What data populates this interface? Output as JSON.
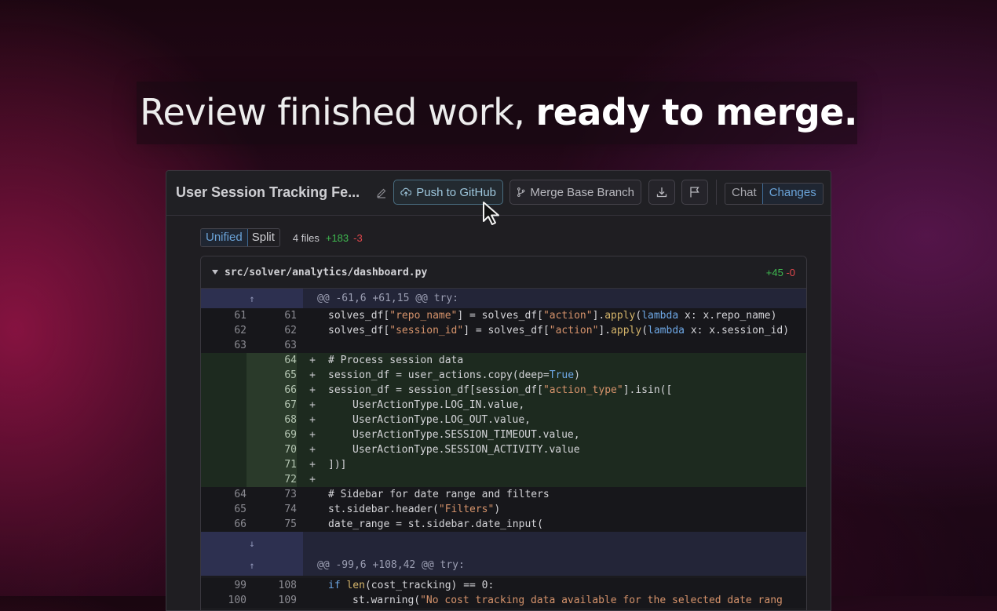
{
  "headline": {
    "regular": "Review finished work, ",
    "bold": "ready to merge."
  },
  "topbar": {
    "title": "User Session Tracking Fe...",
    "push_label": "Push to GitHub",
    "merge_label": "Merge Base Branch",
    "tabs": [
      {
        "label": "Chat",
        "active": false
      },
      {
        "label": "Changes",
        "active": true
      }
    ]
  },
  "viewbar": {
    "modes": [
      {
        "label": "Unified",
        "active": true
      },
      {
        "label": "Split",
        "active": false
      }
    ],
    "file_count": "4 files",
    "additions": "+183",
    "deletions": "-3"
  },
  "file": {
    "path": "src/solver/analytics/dashboard.py",
    "additions": "+45",
    "deletions": "-0",
    "hunk1_header": "@@ -61,6 +61,15 @@ try:",
    "hunk2_header": "@@ -99,6 +108,42 @@ try:"
  },
  "icons": {
    "pencil": "pencil-icon",
    "push": "cloud-upload-icon",
    "merge": "git-branch-icon",
    "download": "download-icon",
    "flag": "flag-icon",
    "cursor": "mouse-pointer-icon"
  },
  "lines": {
    "r1": {
      "old": "61",
      "new": "61"
    },
    "r2": {
      "old": "62",
      "new": "62"
    },
    "r3": {
      "old": "63",
      "new": "63"
    },
    "a1": {
      "new": "64"
    },
    "a2": {
      "new": "65"
    },
    "a3": {
      "new": "66"
    },
    "a4": {
      "new": "67"
    },
    "a5": {
      "new": "68"
    },
    "a6": {
      "new": "69"
    },
    "a7": {
      "new": "70"
    },
    "a8": {
      "new": "71"
    },
    "a9": {
      "new": "72"
    },
    "c1": {
      "old": "64",
      "new": "73"
    },
    "c2": {
      "old": "65",
      "new": "74"
    },
    "c3": {
      "old": "66",
      "new": "75"
    },
    "d1": {
      "old": "99",
      "new": "108"
    },
    "d2": {
      "old": "100",
      "new": "109"
    }
  },
  "code": {
    "r1": [
      "solves_df[",
      "\"repo_name\"",
      "] = solves_df[",
      "\"action\"",
      "].",
      "apply",
      "(",
      "lambda",
      " x: x.repo_name)"
    ],
    "r2": [
      "solves_df[",
      "\"session_id\"",
      "] = solves_df[",
      "\"action\"",
      "].",
      "apply",
      "(",
      "lambda",
      " x: x.session_id)"
    ],
    "a1": "# Process session data",
    "a2": [
      "session_df = user_actions.copy(deep=",
      "True",
      ")"
    ],
    "a3": [
      "session_df = session_df[session_df[",
      "\"action_type\"",
      "].isin(["
    ],
    "a4": "UserActionType.LOG_IN.value,",
    "a5": "UserActionType.LOG_OUT.value,",
    "a6": "UserActionType.SESSION_TIMEOUT.value,",
    "a7": "UserActionType.SESSION_ACTIVITY.value",
    "a8": "])]",
    "c1": "# Sidebar for date range and filters",
    "c2": [
      "st.sidebar.header(",
      "\"Filters\"",
      ")"
    ],
    "c3": "date_range = st.sidebar.date_input(",
    "d1": [
      "if",
      " ",
      "len",
      "(cost_tracking) == 0:"
    ],
    "d2": [
      "st.warning(",
      "\"No cost tracking data available for the selected date rang"
    ]
  },
  "plus": "+",
  "colors": {
    "accent": "#6aa3d8",
    "add": "#3fb950",
    "del": "#e5484d"
  }
}
